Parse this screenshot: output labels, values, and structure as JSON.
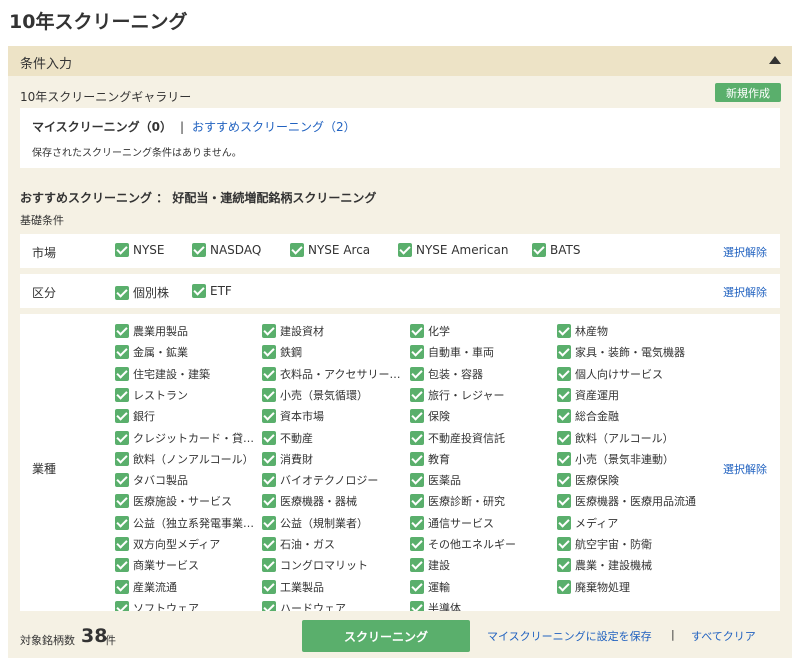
{
  "page_title": "10年スクリーニング",
  "panel": {
    "title": "条件入力",
    "collapse_icon": "triangle-up-icon"
  },
  "gallery": {
    "title": "10年スクリーニングギャラリー",
    "new_button": "新規作成",
    "my_label": "マイスクリーニング（0）",
    "separator": "|",
    "recommended_link": "おすすめスクリーニング（2）",
    "empty_message": "保存されたスクリーニング条件はありません。"
  },
  "recommended_title": "おすすめスクリーニング ： 好配当・連続増配銘柄スクリーニング",
  "basic_title": "基礎条件",
  "market": {
    "label": "市場",
    "clear": "選択解除",
    "items": [
      "NYSE",
      "NASDAQ",
      "NYSE Arca",
      "NYSE American",
      "BATS"
    ]
  },
  "category": {
    "label": "区分",
    "clear": "選択解除",
    "items": [
      "個別株",
      "ETF"
    ]
  },
  "industry": {
    "label": "業種",
    "clear": "選択解除",
    "items": [
      "農業用製品",
      "建設資材",
      "化学",
      "林産物",
      "金属・鉱業",
      "鉄鋼",
      "自動車・車両",
      "家具・装飾・電気機器",
      "住宅建設・建築",
      "衣料品・アクセサリー…",
      "包装・容器",
      "個人向けサービス",
      "レストラン",
      "小売（景気循環）",
      "旅行・レジャー",
      "資産運用",
      "銀行",
      "資本市場",
      "保険",
      "総合金融",
      "クレジットカード・貸…",
      "不動産",
      "不動産投資信託",
      "飲料（アルコール）",
      "飲料（ノンアルコール）",
      "消費財",
      "教育",
      "小売（景気非連動）",
      "タバコ製品",
      "バイオテクノロジー",
      "医薬品",
      "医療保険",
      "医療施設・サービス",
      "医療機器・器械",
      "医療診断・研究",
      "医療機器・医療用品流通",
      "公益（独立系発電事業…",
      "公益（規制業者）",
      "通信サービス",
      "メディア",
      "双方向型メディア",
      "石油・ガス",
      "その他エネルギー",
      "航空宇宙・防衛",
      "商業サービス",
      "コングロマリット",
      "建設",
      "農業・建設機械",
      "産業流通",
      "工業製品",
      "運輸",
      "廃棄物処理",
      "ソフトウェア",
      "ハードウェア",
      "半導体"
    ]
  },
  "footer": {
    "count_label": "対象銘柄数",
    "count": "38",
    "count_unit": "件",
    "screen_button": "スクリーニング",
    "save_link": "マイスクリーニングに設定を保存",
    "separator": "|",
    "clear_all": "すべてクリア"
  },
  "colors": {
    "accent_green": "#5aaf6c",
    "link_blue": "#2162c0",
    "panel_bg": "#f5f1e4",
    "header_bg": "#ede3c6"
  }
}
